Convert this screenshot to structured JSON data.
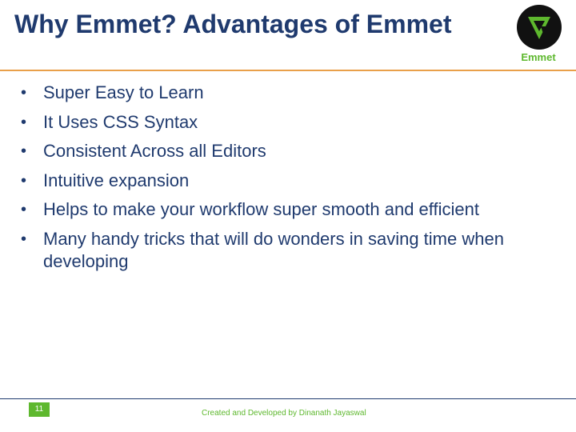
{
  "slide": {
    "title": "Why Emmet? Advantages of Emmet",
    "logo": {
      "icon": "emmet-logo-icon",
      "label": "Emmet",
      "badge_color": "#111111",
      "mark_color": "#5eb82e"
    },
    "bullets": [
      "Super Easy to Learn",
      "It Uses CSS Syntax",
      "Consistent Across all Editors",
      "Intuitive expansion",
      "Helps to make your workflow super smooth and efficient",
      "Many handy tricks that will do wonders in saving time when developing"
    ],
    "bullet_glyph": "•"
  },
  "footer": {
    "page_number": "11",
    "credit": "Created and Developed by Dinanath Jayaswal"
  },
  "colors": {
    "title": "#1f3a6e",
    "accent_rule": "#e9a04a",
    "green": "#5eb82e",
    "footer_rule": "#1f3a6e"
  }
}
